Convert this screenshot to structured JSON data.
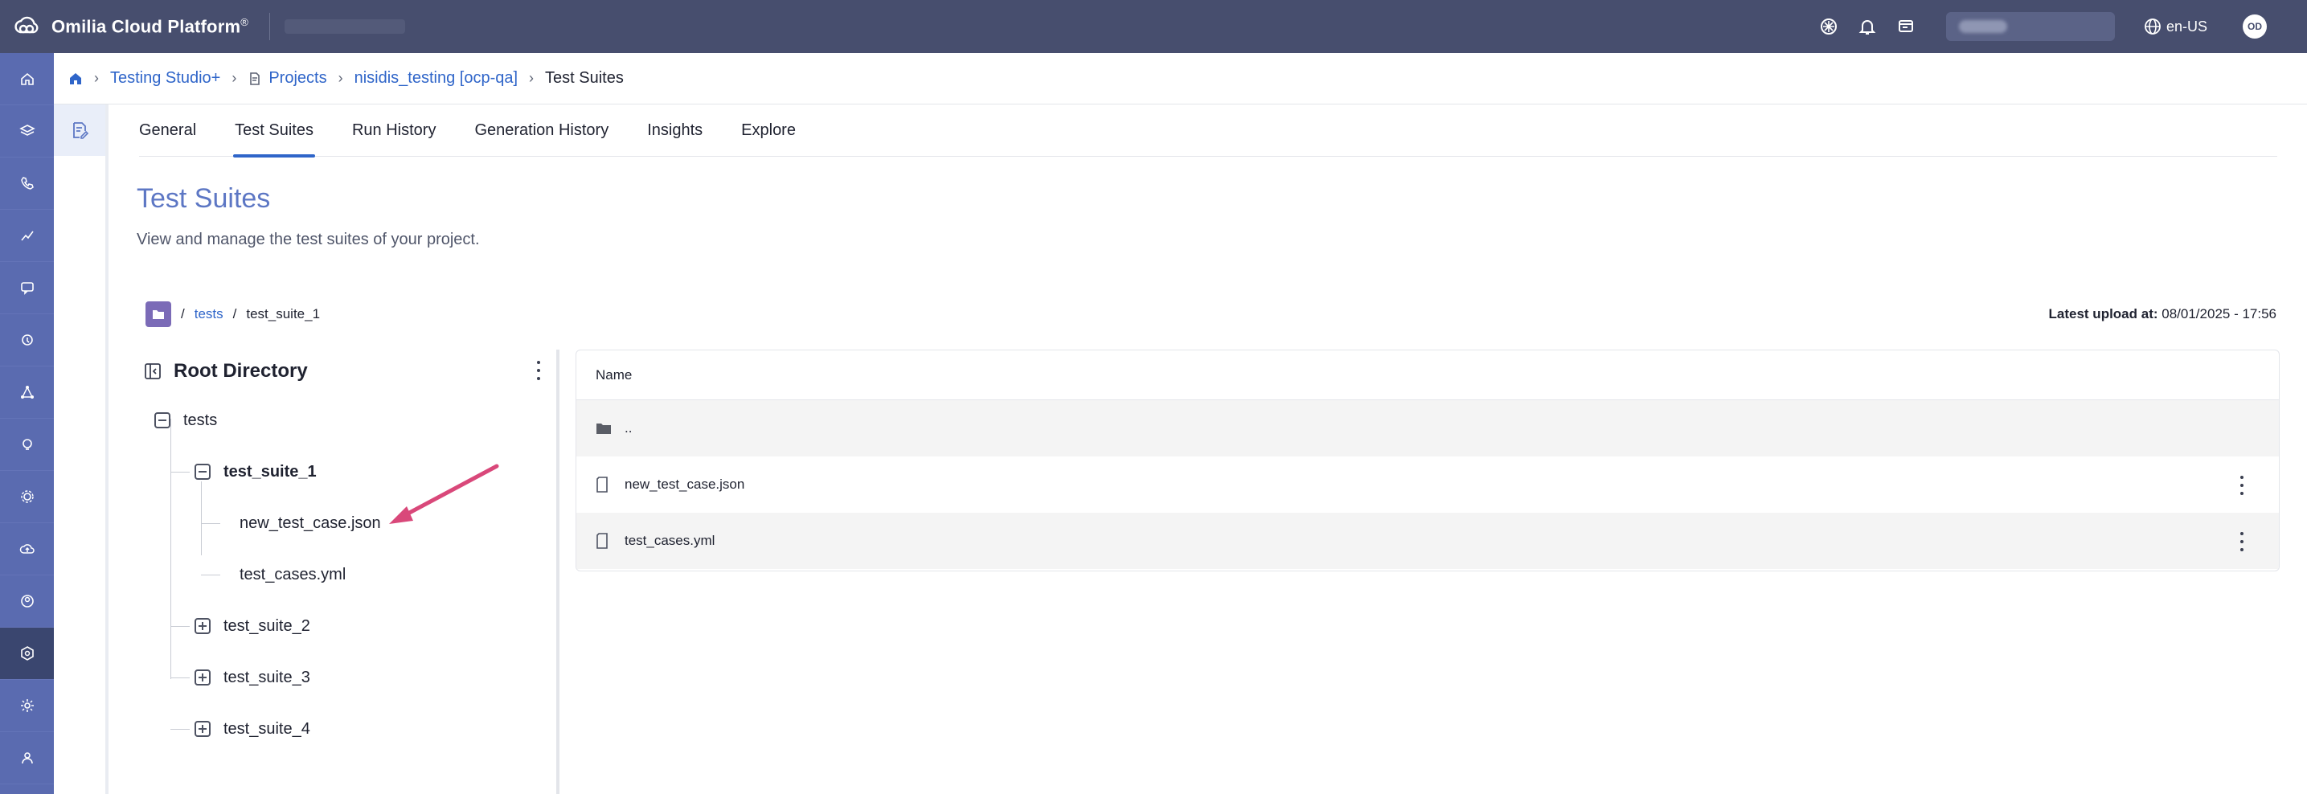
{
  "app": {
    "brand": "Omilia Cloud Platform",
    "brand_mark": "®",
    "language": "en-US",
    "avatar_initials": "OD"
  },
  "colors": {
    "topbar": "#474e6e",
    "rail": "#5a6bb0",
    "rail_active": "#3a466f",
    "link": "#2f65c9",
    "title": "#5d77c4",
    "arrow": "#d9487a"
  },
  "breadcrumb": {
    "studio": "Testing Studio+",
    "projects": "Projects",
    "project": "nisidis_testing [ocp-qa]",
    "current": "Test Suites"
  },
  "tabs": [
    "General",
    "Test Suites",
    "Run History",
    "Generation History",
    "Insights",
    "Explore"
  ],
  "active_tab": "Test Suites",
  "page": {
    "title": "Test Suites",
    "subtitle": "View and manage the test suites of your project."
  },
  "path": {
    "root_link": "tests",
    "current": "test_suite_1"
  },
  "latest_upload": {
    "label": "Latest upload at:",
    "value": "08/01/2025 - 17:56"
  },
  "tree": {
    "title": "Root Directory",
    "root": "tests",
    "suite_1": "test_suite_1",
    "file_1": "new_test_case.json",
    "file_2": "test_cases.yml",
    "suite_2": "test_suite_2",
    "suite_3": "test_suite_3",
    "suite_4": "test_suite_4"
  },
  "files": {
    "header": "Name",
    "rows": [
      "..",
      "new_test_case.json",
      "test_cases.yml"
    ]
  },
  "rail_icons": [
    "home-icon",
    "layers-icon",
    "phone-icon",
    "analytics-icon",
    "chat-icon",
    "support-icon",
    "network-icon",
    "lightbulb-icon",
    "gear-wheel-icon",
    "cloud-upload-icon",
    "users-icon",
    "testing-icon",
    "settings-icon",
    "admin-icon"
  ]
}
